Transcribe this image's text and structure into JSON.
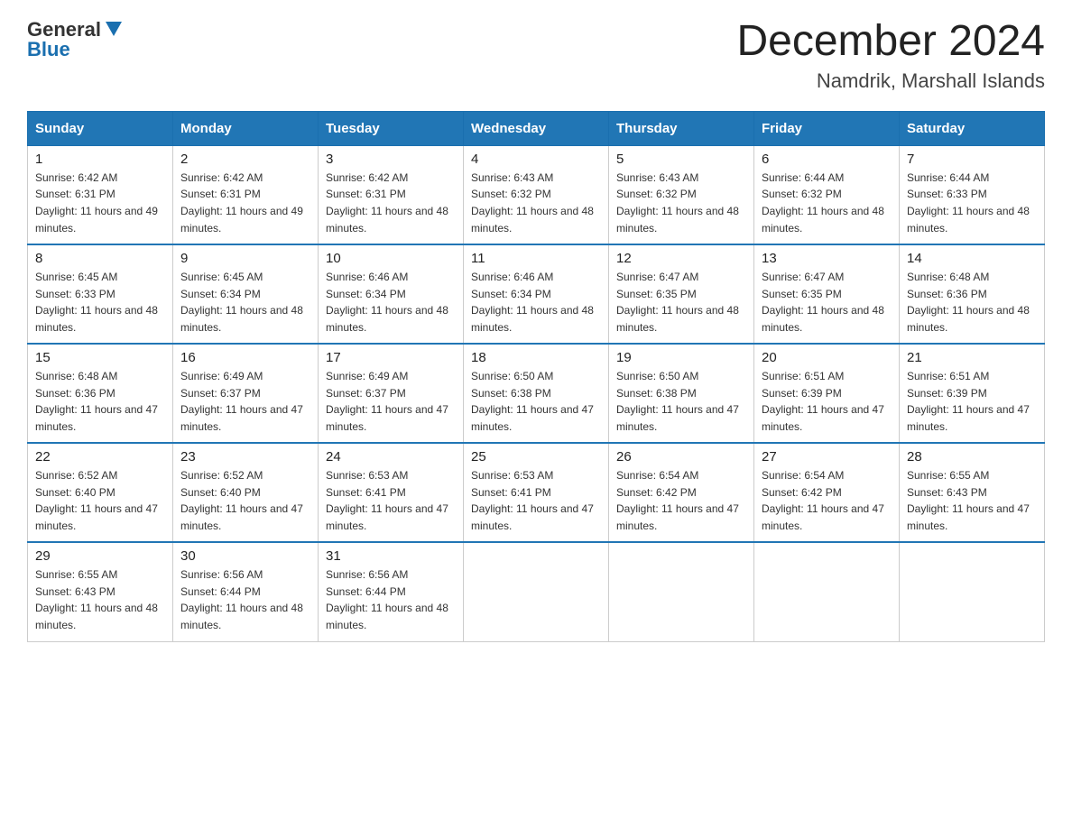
{
  "header": {
    "logo_general": "General",
    "logo_blue": "Blue",
    "month_title": "December 2024",
    "location": "Namdrik, Marshall Islands"
  },
  "days_of_week": [
    "Sunday",
    "Monday",
    "Tuesday",
    "Wednesday",
    "Thursday",
    "Friday",
    "Saturday"
  ],
  "weeks": [
    [
      {
        "day": "1",
        "sunrise": "6:42 AM",
        "sunset": "6:31 PM",
        "daylight": "11 hours and 49 minutes."
      },
      {
        "day": "2",
        "sunrise": "6:42 AM",
        "sunset": "6:31 PM",
        "daylight": "11 hours and 49 minutes."
      },
      {
        "day": "3",
        "sunrise": "6:42 AM",
        "sunset": "6:31 PM",
        "daylight": "11 hours and 48 minutes."
      },
      {
        "day": "4",
        "sunrise": "6:43 AM",
        "sunset": "6:32 PM",
        "daylight": "11 hours and 48 minutes."
      },
      {
        "day": "5",
        "sunrise": "6:43 AM",
        "sunset": "6:32 PM",
        "daylight": "11 hours and 48 minutes."
      },
      {
        "day": "6",
        "sunrise": "6:44 AM",
        "sunset": "6:32 PM",
        "daylight": "11 hours and 48 minutes."
      },
      {
        "day": "7",
        "sunrise": "6:44 AM",
        "sunset": "6:33 PM",
        "daylight": "11 hours and 48 minutes."
      }
    ],
    [
      {
        "day": "8",
        "sunrise": "6:45 AM",
        "sunset": "6:33 PM",
        "daylight": "11 hours and 48 minutes."
      },
      {
        "day": "9",
        "sunrise": "6:45 AM",
        "sunset": "6:34 PM",
        "daylight": "11 hours and 48 minutes."
      },
      {
        "day": "10",
        "sunrise": "6:46 AM",
        "sunset": "6:34 PM",
        "daylight": "11 hours and 48 minutes."
      },
      {
        "day": "11",
        "sunrise": "6:46 AM",
        "sunset": "6:34 PM",
        "daylight": "11 hours and 48 minutes."
      },
      {
        "day": "12",
        "sunrise": "6:47 AM",
        "sunset": "6:35 PM",
        "daylight": "11 hours and 48 minutes."
      },
      {
        "day": "13",
        "sunrise": "6:47 AM",
        "sunset": "6:35 PM",
        "daylight": "11 hours and 48 minutes."
      },
      {
        "day": "14",
        "sunrise": "6:48 AM",
        "sunset": "6:36 PM",
        "daylight": "11 hours and 48 minutes."
      }
    ],
    [
      {
        "day": "15",
        "sunrise": "6:48 AM",
        "sunset": "6:36 PM",
        "daylight": "11 hours and 47 minutes."
      },
      {
        "day": "16",
        "sunrise": "6:49 AM",
        "sunset": "6:37 PM",
        "daylight": "11 hours and 47 minutes."
      },
      {
        "day": "17",
        "sunrise": "6:49 AM",
        "sunset": "6:37 PM",
        "daylight": "11 hours and 47 minutes."
      },
      {
        "day": "18",
        "sunrise": "6:50 AM",
        "sunset": "6:38 PM",
        "daylight": "11 hours and 47 minutes."
      },
      {
        "day": "19",
        "sunrise": "6:50 AM",
        "sunset": "6:38 PM",
        "daylight": "11 hours and 47 minutes."
      },
      {
        "day": "20",
        "sunrise": "6:51 AM",
        "sunset": "6:39 PM",
        "daylight": "11 hours and 47 minutes."
      },
      {
        "day": "21",
        "sunrise": "6:51 AM",
        "sunset": "6:39 PM",
        "daylight": "11 hours and 47 minutes."
      }
    ],
    [
      {
        "day": "22",
        "sunrise": "6:52 AM",
        "sunset": "6:40 PM",
        "daylight": "11 hours and 47 minutes."
      },
      {
        "day": "23",
        "sunrise": "6:52 AM",
        "sunset": "6:40 PM",
        "daylight": "11 hours and 47 minutes."
      },
      {
        "day": "24",
        "sunrise": "6:53 AM",
        "sunset": "6:41 PM",
        "daylight": "11 hours and 47 minutes."
      },
      {
        "day": "25",
        "sunrise": "6:53 AM",
        "sunset": "6:41 PM",
        "daylight": "11 hours and 47 minutes."
      },
      {
        "day": "26",
        "sunrise": "6:54 AM",
        "sunset": "6:42 PM",
        "daylight": "11 hours and 47 minutes."
      },
      {
        "day": "27",
        "sunrise": "6:54 AM",
        "sunset": "6:42 PM",
        "daylight": "11 hours and 47 minutes."
      },
      {
        "day": "28",
        "sunrise": "6:55 AM",
        "sunset": "6:43 PM",
        "daylight": "11 hours and 47 minutes."
      }
    ],
    [
      {
        "day": "29",
        "sunrise": "6:55 AM",
        "sunset": "6:43 PM",
        "daylight": "11 hours and 48 minutes."
      },
      {
        "day": "30",
        "sunrise": "6:56 AM",
        "sunset": "6:44 PM",
        "daylight": "11 hours and 48 minutes."
      },
      {
        "day": "31",
        "sunrise": "6:56 AM",
        "sunset": "6:44 PM",
        "daylight": "11 hours and 48 minutes."
      },
      null,
      null,
      null,
      null
    ]
  ]
}
